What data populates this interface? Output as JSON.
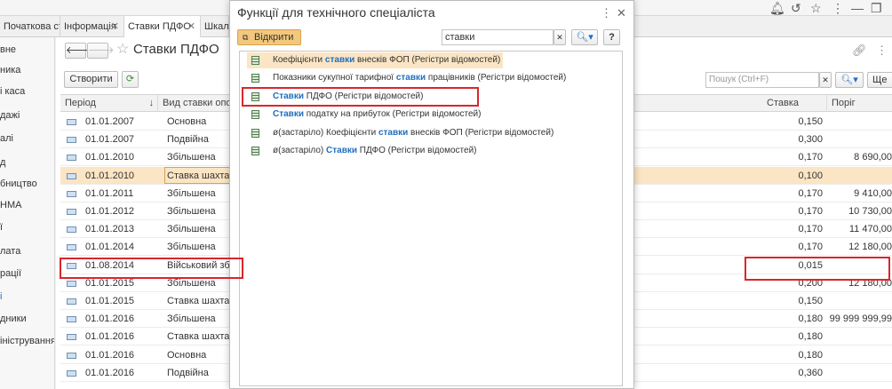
{
  "tabs": [
    {
      "label": "Початкова сторінка",
      "closable": false
    },
    {
      "label": "Інформація",
      "closable": true
    },
    {
      "label": "Ставки ПДФО",
      "closable": true
    },
    {
      "label": "Шкал",
      "closable": false
    }
  ],
  "sidebar": {
    "items": [
      "вне",
      "ника",
      "і каса",
      "дажі",
      "алі",
      "д",
      "бництво",
      "НМА",
      "ї",
      "лата",
      "рації",
      "і",
      "дники",
      "іністрування"
    ]
  },
  "main": {
    "title": "Ставки ПДФО",
    "create_label": "Створити",
    "search_placeholder": "Пошук (Ctrl+F)",
    "more_label": "Ще",
    "columns": {
      "period": "Період",
      "rate_type": "Вид ставки опод",
      "rate": "Ставка",
      "threshold": "Поріг"
    },
    "rows": [
      {
        "period": "01.01.2007",
        "type": "Основна",
        "rate": "0,150",
        "threshold": ""
      },
      {
        "period": "01.01.2007",
        "type": "Подвійна",
        "rate": "0,300",
        "threshold": ""
      },
      {
        "period": "01.01.2010",
        "type": "Збільшена",
        "rate": "0,170",
        "threshold": "8 690,00"
      },
      {
        "period": "01.01.2010",
        "type": "Ставка шахтарів",
        "rate": "0,100",
        "threshold": ""
      },
      {
        "period": "01.01.2011",
        "type": "Збільшена",
        "rate": "0,170",
        "threshold": "9 410,00"
      },
      {
        "period": "01.01.2012",
        "type": "Збільшена",
        "rate": "0,170",
        "threshold": "10 730,00"
      },
      {
        "period": "01.01.2013",
        "type": "Збільшена",
        "rate": "0,170",
        "threshold": "11 470,00"
      },
      {
        "period": "01.01.2014",
        "type": "Збільшена",
        "rate": "0,170",
        "threshold": "12 180,00"
      },
      {
        "period": "01.08.2014",
        "type": "Військовий збір",
        "rate": "0,015",
        "threshold": ""
      },
      {
        "period": "01.01.2015",
        "type": "Збільшена",
        "rate": "0,200",
        "threshold": "12 180,00"
      },
      {
        "period": "01.01.2015",
        "type": "Ставка шахтарів",
        "rate": "0,150",
        "threshold": ""
      },
      {
        "period": "01.01.2016",
        "type": "Збільшена",
        "rate": "0,180",
        "threshold": "99 999 999,99"
      },
      {
        "period": "01.01.2016",
        "type": "Ставка шахтарів",
        "rate": "0,180",
        "threshold": ""
      },
      {
        "period": "01.01.2016",
        "type": "Основна",
        "rate": "0,180",
        "threshold": ""
      },
      {
        "period": "01.01.2016",
        "type": "Подвійна",
        "rate": "0,360",
        "threshold": ""
      }
    ]
  },
  "dialog": {
    "title": "Функції для технічного спеціаліста",
    "open_label": "Відкрити",
    "search_value": "ставки",
    "help_label": "?",
    "items": [
      {
        "pre": "Коефіцієнти ",
        "hl": "ставки",
        "post": " внесків ФОП (Регістри відомостей)"
      },
      {
        "pre": "Показники сукупної тарифної ",
        "hl": "ставки",
        "post": " працівників (Регістри відомостей)"
      },
      {
        "pre": "",
        "hl": "Ставки",
        "post": " ПДФО (Регістри відомостей)"
      },
      {
        "pre": "",
        "hl": "Ставки",
        "post": " податку на прибуток (Регістри відомостей)"
      },
      {
        "pre": "ø(застаріло) Коефіцієнти ",
        "hl": "ставки",
        "post": " внесків ФОП (Регістри відомостей)"
      },
      {
        "pre": "ø(застаріло) ",
        "hl": "Ставки",
        "post": " ПДФО (Регістри відомостей)"
      }
    ]
  },
  "colors": {
    "accent": "#1f6ebf",
    "selection": "#fbe5c4",
    "highlight_box": "#d9262c",
    "open_button": "#f3c77c"
  }
}
